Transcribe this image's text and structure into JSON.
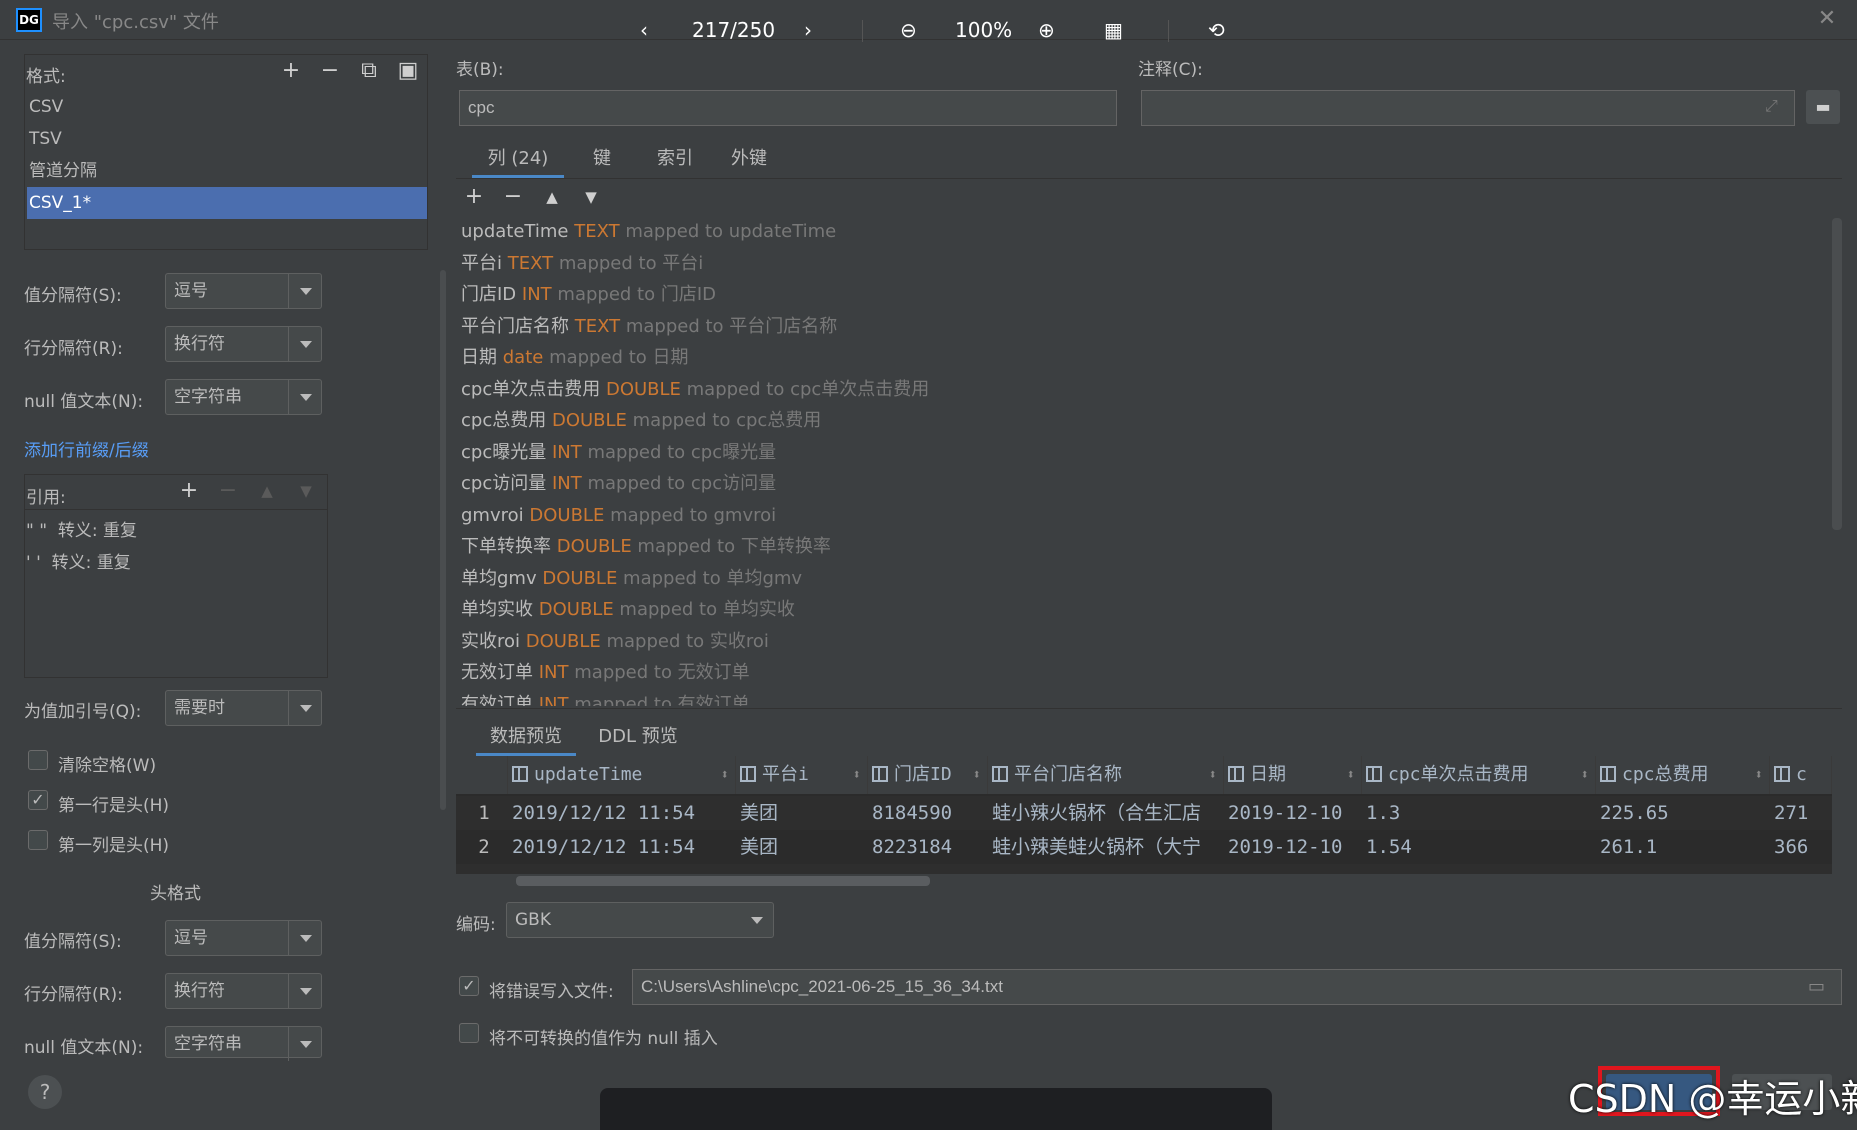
{
  "window": {
    "logo": "DG",
    "title": "导入 \"cpc.csv\" 文件",
    "close_glyph": "✕"
  },
  "format": {
    "label": "格式:",
    "items": [
      "CSV",
      "TSV",
      "管道分隔",
      "CSV_1*"
    ],
    "selected_index": 3
  },
  "settings": {
    "value_sep": {
      "label": "值分隔符(S):",
      "value": "逗号"
    },
    "row_sep": {
      "label": "行分隔符(R):",
      "value": "换行符"
    },
    "null_text": {
      "label": "null 值文本(N):",
      "value": "空字符串"
    },
    "prefix_link": "添加行前缀/后缀",
    "quote_label": "引用:",
    "quotes": [
      {
        "chars": "\"  \"",
        "desc": "转义: 重复"
      },
      {
        "chars": "'  '",
        "desc": "转义: 重复"
      }
    ],
    "quote_values": {
      "label": "为值加引号(Q):",
      "value": "需要时"
    },
    "trim": {
      "label": "清除空格(W)",
      "checked": false
    },
    "first_row_header": {
      "label": "第一行是头(H)",
      "checked": true
    },
    "first_col_header": {
      "label": "第一列是头(H)",
      "checked": false
    },
    "header_format_title": "头格式",
    "h_value_sep": {
      "label": "值分隔符(S):",
      "value": "逗号"
    },
    "h_row_sep": {
      "label": "行分隔符(R):",
      "value": "换行符"
    },
    "h_null_text": {
      "label": "null 值文本(N):",
      "value": "空字符串"
    },
    "help": "?"
  },
  "table": {
    "label": "表(B):",
    "value": "cpc"
  },
  "comment": {
    "label": "注释(C):",
    "value": ""
  },
  "column_tabs": [
    "列 (24)",
    "键",
    "索引",
    "外键"
  ],
  "columns": [
    {
      "name": "updateTime",
      "type": "TEXT",
      "map": "mapped to updateTime"
    },
    {
      "name": "平台i",
      "type": "TEXT",
      "map": "mapped to 平台i"
    },
    {
      "name": "门店ID",
      "type": "INT",
      "map": "mapped to 门店ID"
    },
    {
      "name": "平台门店名称",
      "type": "TEXT",
      "map": "mapped to 平台门店名称"
    },
    {
      "name": "日期",
      "type": "date",
      "map": "mapped to 日期"
    },
    {
      "name": "cpc单次点击费用",
      "type": "DOUBLE",
      "map": "mapped to cpc单次点击费用"
    },
    {
      "name": "cpc总费用",
      "type": "DOUBLE",
      "map": "mapped to cpc总费用"
    },
    {
      "name": "cpc曝光量",
      "type": "INT",
      "map": "mapped to cpc曝光量"
    },
    {
      "name": "cpc访问量",
      "type": "INT",
      "map": "mapped to cpc访问量"
    },
    {
      "name": "gmvroi",
      "type": "DOUBLE",
      "map": "mapped to gmvroi"
    },
    {
      "name": "下单转换率",
      "type": "DOUBLE",
      "map": "mapped to 下单转换率"
    },
    {
      "name": "单均gmv",
      "type": "DOUBLE",
      "map": "mapped to 单均gmv"
    },
    {
      "name": "单均实收",
      "type": "DOUBLE",
      "map": "mapped to 单均实收"
    },
    {
      "name": "实收roi",
      "type": "DOUBLE",
      "map": "mapped to 实收roi"
    },
    {
      "name": "无效订单",
      "type": "INT",
      "map": "mapped to 无效订单"
    },
    {
      "name": "有效订单",
      "type": "INT",
      "map": "mapped to 有效订单"
    }
  ],
  "preview_tabs": [
    "数据预览",
    "DDL 预览"
  ],
  "grid": {
    "headers": [
      "updateTime",
      "平台i",
      "门店ID",
      "平台门店名称",
      "日期",
      "cpc单次点击费用",
      "cpc总费用",
      "c"
    ],
    "rows": [
      {
        "num": "1",
        "cells": [
          "2019/12/12 11:54",
          "美团",
          "8184590",
          "蛙小辣火锅杯（合生汇店",
          "2019-12-10",
          "1.3",
          "225.65",
          "271"
        ]
      },
      {
        "num": "2",
        "cells": [
          "2019/12/12 11:54",
          "美团",
          "8223184",
          "蛙小辣美蛙火锅杯（大宁",
          "2019-12-10",
          "1.54",
          "261.1",
          "366"
        ]
      }
    ]
  },
  "encoding": {
    "label": "编码:",
    "value": "GBK"
  },
  "error_file": {
    "label": "将错误写入文件:",
    "checked": true,
    "path": "C:\\Users\\Ashline\\cpc_2021-06-25_15_36_34.txt"
  },
  "null_insert": {
    "label": "将不可转换的值作为 null 插入",
    "checked": false
  },
  "viewer": {
    "page": "217/250",
    "zoom": "100%"
  },
  "watermark": "CSDN @幸运小新",
  "colors": {
    "accent": "#4b6eaf",
    "type": "#cc7832",
    "link": "#589df6",
    "highlight": "#e0161e"
  }
}
